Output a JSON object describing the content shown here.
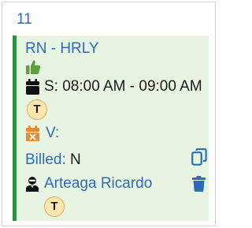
{
  "day": {
    "number": "11"
  },
  "shift": {
    "code": "RN - HRLY",
    "schedule": "S: 08:00 AM - 09:00 AM",
    "badge": "T",
    "v_label": "V:",
    "billed_label": "Billed:",
    "billed_value": "N",
    "employee_name": "Arteaga Ricardo",
    "employee_badge": "T"
  },
  "colors": {
    "accent_blue": "#2f6bb5",
    "card_bg": "#e8f4e2",
    "card_border": "#2f8f3e",
    "thumb_green": "#5aa13a",
    "badge_bg": "#fbe6b0",
    "badge_border": "#e0b24c",
    "cancel_orange": "#e28b3b"
  },
  "icons": {
    "approval": "thumbs-up-icon",
    "schedule": "calendar-icon",
    "cancel": "calendar-x-icon",
    "copy": "copy-icon",
    "employee": "person-icon",
    "delete": "trash-icon"
  }
}
